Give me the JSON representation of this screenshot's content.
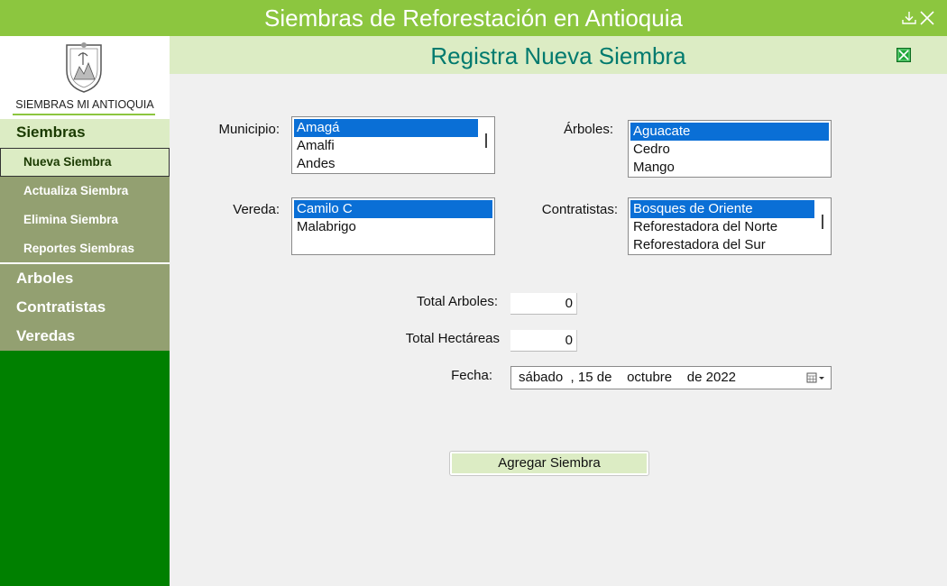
{
  "window": {
    "title": "Siembras de Reforestación en Antioquia",
    "download_icon": "download-icon",
    "close_icon": "close-icon"
  },
  "sidebar": {
    "logo_text": "SIEMBRAS MI ANTIOQUIA",
    "section": "Siembras",
    "sub_items": [
      {
        "label": "Nueva Siembra"
      },
      {
        "label": "Actualiza Siembra"
      },
      {
        "label": "Elimina Siembra"
      },
      {
        "label": "Reportes Siembras"
      }
    ],
    "main_items": [
      {
        "label": "Arboles"
      },
      {
        "label": "Contratistas"
      },
      {
        "label": "Veredas"
      }
    ]
  },
  "header": {
    "title": "Registra Nueva Siembra",
    "export_icon": "excel-export-icon"
  },
  "form": {
    "municipio": {
      "label": "Municipio:",
      "options": [
        "Amagá",
        "Amalfi",
        "Andes"
      ],
      "selected": "Amagá"
    },
    "arboles": {
      "label": "Árboles:",
      "options": [
        "Aguacate",
        "Cedro",
        "Mango"
      ],
      "selected": "Aguacate"
    },
    "vereda": {
      "label": "Vereda:",
      "options": [
        "Camilo C",
        "Malabrigo"
      ],
      "selected": "Camilo C"
    },
    "contratistas": {
      "label": "Contratistas:",
      "options": [
        "Bosques de Oriente",
        "Reforestadora del Norte",
        "Reforestadora del Sur"
      ],
      "selected": "Bosques de Oriente"
    },
    "total_arboles": {
      "label": "Total Arboles:",
      "value": "0"
    },
    "total_hectareas": {
      "label": "Total Hectáreas",
      "value": "0"
    },
    "fecha": {
      "label": "Fecha:",
      "value": "sábado  , 15 de    octubre    de 2022"
    },
    "submit_label": "Agregar Siembra"
  },
  "colors": {
    "title_bar": "#8cc63f",
    "sidebar": "#008000",
    "sidebar_group": "#93a071",
    "light_green": "#dcecc4",
    "title_text": "#007a6e",
    "selection": "#0a6fd6"
  }
}
